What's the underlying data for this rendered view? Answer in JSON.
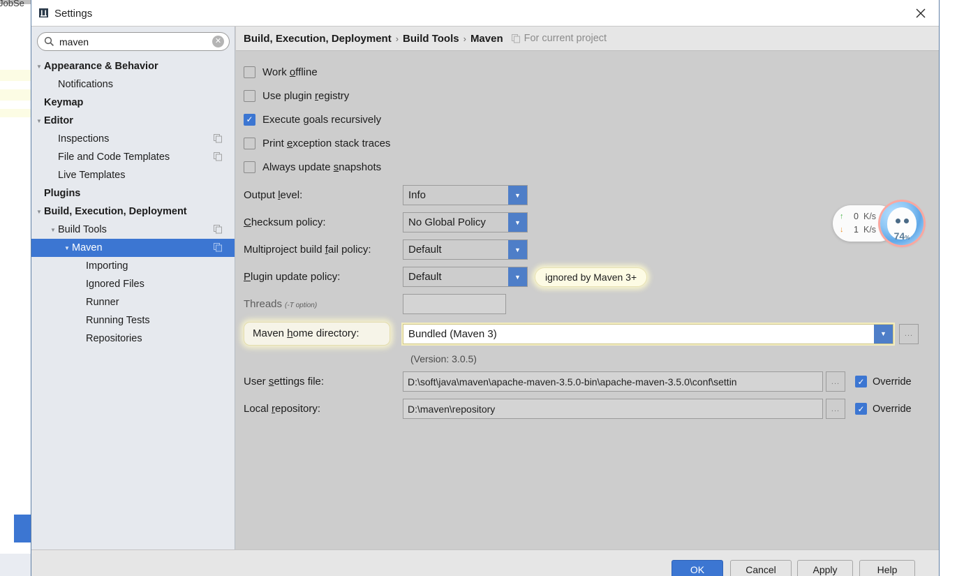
{
  "background": {
    "editor_text": "JobSe"
  },
  "window": {
    "title": "Settings",
    "title_icon": "settings-app-icon",
    "close_icon": "close-icon"
  },
  "sidebar": {
    "search": {
      "value": "maven",
      "placeholder": "",
      "icon": "search-icon",
      "clear_icon": "clear-circle-icon"
    },
    "items": [
      {
        "label": "Appearance & Behavior",
        "indent": 0,
        "bold": true,
        "twisty": "down",
        "copy": false,
        "selected": false
      },
      {
        "label": "Notifications",
        "indent": 1,
        "bold": false,
        "twisty": "none",
        "copy": false,
        "selected": false
      },
      {
        "label": "Keymap",
        "indent": 0,
        "bold": true,
        "twisty": "none",
        "copy": false,
        "selected": false
      },
      {
        "label": "Editor",
        "indent": 0,
        "bold": true,
        "twisty": "down",
        "copy": false,
        "selected": false
      },
      {
        "label": "Inspections",
        "indent": 1,
        "bold": false,
        "twisty": "none",
        "copy": true,
        "selected": false
      },
      {
        "label": "File and Code Templates",
        "indent": 1,
        "bold": false,
        "twisty": "none",
        "copy": true,
        "selected": false
      },
      {
        "label": "Live Templates",
        "indent": 1,
        "bold": false,
        "twisty": "none",
        "copy": false,
        "selected": false
      },
      {
        "label": "Plugins",
        "indent": 0,
        "bold": true,
        "twisty": "none",
        "copy": false,
        "selected": false
      },
      {
        "label": "Build, Execution, Deployment",
        "indent": 0,
        "bold": true,
        "twisty": "down",
        "copy": false,
        "selected": false
      },
      {
        "label": "Build Tools",
        "indent": 1,
        "bold": false,
        "twisty": "down",
        "copy": true,
        "selected": false
      },
      {
        "label": "Maven",
        "indent": 2,
        "bold": false,
        "twisty": "down",
        "copy": true,
        "selected": true
      },
      {
        "label": "Importing",
        "indent": 3,
        "bold": false,
        "twisty": "none",
        "copy": false,
        "selected": false
      },
      {
        "label": "Ignored Files",
        "indent": 3,
        "bold": false,
        "twisty": "none",
        "copy": false,
        "selected": false
      },
      {
        "label": "Runner",
        "indent": 3,
        "bold": false,
        "twisty": "none",
        "copy": false,
        "selected": false
      },
      {
        "label": "Running Tests",
        "indent": 3,
        "bold": false,
        "twisty": "none",
        "copy": false,
        "selected": false
      },
      {
        "label": "Repositories",
        "indent": 3,
        "bold": false,
        "twisty": "none",
        "copy": false,
        "selected": false
      }
    ]
  },
  "breadcrumb": {
    "segments": [
      "Build, Execution, Deployment",
      "Build Tools",
      "Maven"
    ],
    "separator": "›",
    "project_scope_label": "For current project",
    "project_scope_icon": "copy-icon"
  },
  "main": {
    "checkboxes": [
      {
        "label_pre": "Work ",
        "label_key": "o",
        "label_post": "ffline",
        "checked": false
      },
      {
        "label_pre": "Use plugin ",
        "label_key": "r",
        "label_post": "egistry",
        "checked": false
      },
      {
        "label_pre": "Execute ",
        "label_key": "g",
        "label_post": "oals recursively",
        "checked": true
      },
      {
        "label_pre": "Print ",
        "label_key": "e",
        "label_post": "xception stack traces",
        "checked": false
      },
      {
        "label_pre": "Always update ",
        "label_key": "s",
        "label_post": "napshots",
        "checked": false
      }
    ],
    "output_level": {
      "label_pre": "Output ",
      "label_key": "l",
      "label_post": "evel:",
      "value": "Info"
    },
    "checksum_policy": {
      "label_pre": "",
      "label_key": "C",
      "label_post": "hecksum policy:",
      "value": "No Global Policy"
    },
    "multiproject_fail_policy": {
      "label_pre": "Multiproject build ",
      "label_key": "f",
      "label_post": "ail policy:",
      "value": "Default"
    },
    "plugin_update_policy": {
      "label_pre": "",
      "label_key": "P",
      "label_post": "lugin update policy:",
      "value": "Default",
      "callout": "ignored by Maven 3+"
    },
    "threads": {
      "label": "Threads",
      "label_sub": "(-T option)",
      "value": "",
      "placeholder": ""
    },
    "maven_home": {
      "label_pre": "Maven ",
      "label_key": "h",
      "label_post": "ome directory:",
      "value": "Bundled (Maven 3)",
      "version_note": "(Version: 3.0.5)",
      "browse_label": "..."
    },
    "user_settings_file": {
      "label_pre": "User ",
      "label_key": "s",
      "label_post": "ettings file:",
      "value": "D:\\soft\\java\\maven\\apache-maven-3.5.0-bin\\apache-maven-3.5.0\\conf\\settin",
      "browse_label": "...",
      "override_label": "Override",
      "override_checked": true
    },
    "local_repository": {
      "label_pre": "Local ",
      "label_key": "r",
      "label_post": "epository:",
      "value": "D:\\maven\\repository",
      "browse_label": "...",
      "override_label": "Override",
      "override_checked": true
    }
  },
  "footer": {
    "ok": "OK",
    "cancel": "Cancel",
    "apply": "Apply",
    "help": "Help"
  },
  "net_widget": {
    "upload_value": "0",
    "upload_unit": "K/s",
    "upload_icon": "arrow-up-icon",
    "download_value": "1",
    "download_unit": "K/s",
    "download_icon": "arrow-down-icon",
    "percent": "74",
    "percent_unit": "%",
    "avatar_icon": "penguin-avatar-icon"
  },
  "colors": {
    "accent": "#3c76d2",
    "dialog_bg": "#cdcdcd",
    "sidebar_bg": "#e6e9ee",
    "callout_bg": "#fdfbe4",
    "upload_arrow": "#49b349",
    "download_arrow": "#eb8f2a"
  }
}
